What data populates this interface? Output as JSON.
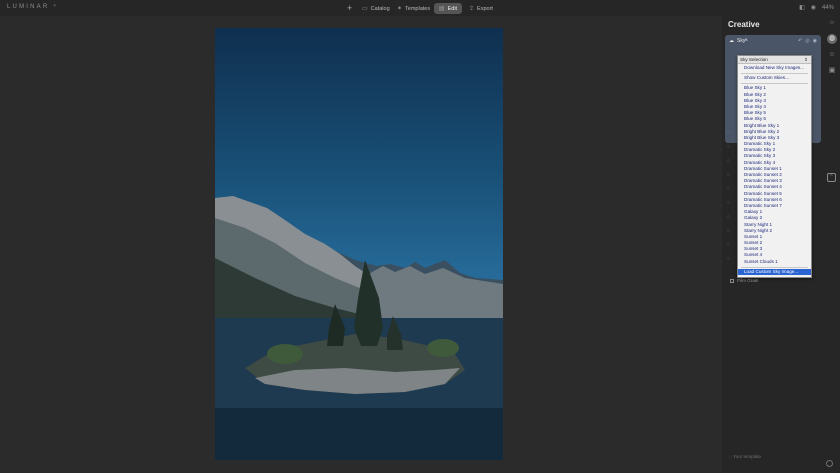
{
  "app": {
    "logo": "LUMINAR ⁴"
  },
  "topnav": {
    "add": "+",
    "items": [
      {
        "label": "Catalog",
        "icon": "folder-icon"
      },
      {
        "label": "Templates",
        "icon": "templates-icon"
      },
      {
        "label": "Edit",
        "icon": "edit-icon"
      },
      {
        "label": "Export",
        "icon": "export-icon"
      }
    ],
    "zoom": "44%"
  },
  "panel": {
    "title": "Creative",
    "sky": {
      "label": "Sky",
      "beta_mark": "ᴮ"
    },
    "film_grain": "Film Grain",
    "template_placeholder": "Your template"
  },
  "dropdown": {
    "title": "Sky Selection",
    "top_items": [
      "Download New Sky Images...",
      "Show Custom Skies..."
    ],
    "skies": [
      "Blue Sky 1",
      "Blue Sky 2",
      "Blue Sky 3",
      "Blue Sky 4",
      "Blue Sky 5",
      "Blue Sky 6",
      "Bright Blue Sky 1",
      "Bright Blue Sky 2",
      "Bright Blue Sky 3",
      "Dramatic Sky 1",
      "Dramatic Sky 2",
      "Dramatic Sky 3",
      "Dramatic Sky 4",
      "Dramatic Sunset 1",
      "Dramatic Sunset 2",
      "Dramatic Sunset 3",
      "Dramatic Sunset 4",
      "Dramatic Sunset 5",
      "Dramatic Sunset 6",
      "Dramatic Sunset 7",
      "Galaxy 1",
      "Galaxy 2",
      "Starry Night 1",
      "Starry Night 2",
      "Sunset 1",
      "Sunset 2",
      "Sunset 3",
      "Sunset 4",
      "Sunset Clouds 1"
    ],
    "load_custom": "Load Custom Sky Image..."
  },
  "colors": {
    "accent": "#2a64d2",
    "panel_bg": "#262627",
    "canvas_bg": "#2b2b2c"
  }
}
